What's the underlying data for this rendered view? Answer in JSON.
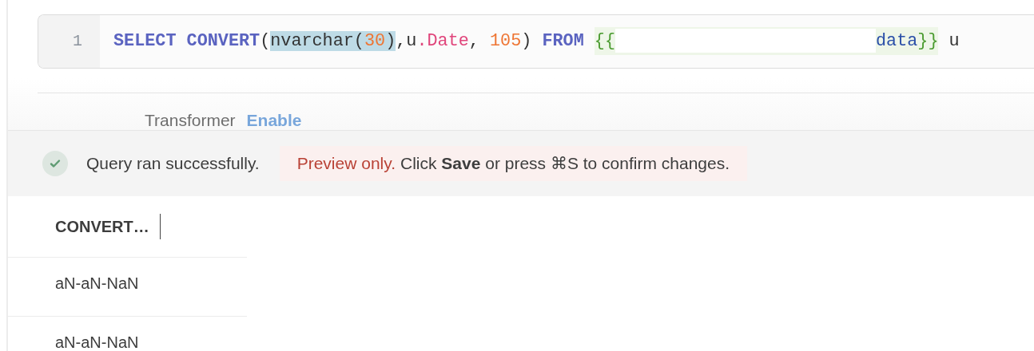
{
  "editor": {
    "line_number": "1",
    "segments": [
      {
        "selected": false,
        "tokens": [
          {
            "kind": "keyword",
            "text": "SELECT"
          },
          {
            "kind": "space"
          },
          {
            "kind": "keyword",
            "text": "CONVERT"
          },
          {
            "kind": "punct",
            "text": "("
          }
        ]
      },
      {
        "selected": true,
        "tokens": [
          {
            "kind": "ident",
            "text": "nvarchar("
          },
          {
            "kind": "number",
            "text": "30"
          },
          {
            "kind": "punct",
            "text": ")"
          }
        ]
      },
      {
        "selected": false,
        "tokens": [
          {
            "kind": "punct",
            "text": ",u"
          },
          {
            "kind": "field",
            "text": ".Date"
          },
          {
            "kind": "punct",
            "text": ", "
          },
          {
            "kind": "number",
            "text": "105"
          },
          {
            "kind": "punct",
            "text": ")"
          },
          {
            "kind": "space"
          },
          {
            "kind": "keyword",
            "text": "FROM"
          },
          {
            "kind": "space"
          },
          {
            "kind": "template",
            "open": "{{",
            "name": "data",
            "close": "}}"
          },
          {
            "kind": "space"
          },
          {
            "kind": "ident",
            "text": "u"
          }
        ]
      }
    ]
  },
  "transformer": {
    "label": "Transformer",
    "action": "Enable"
  },
  "status": {
    "ok": true,
    "message": "Query ran successfully.",
    "notice": "Preview only.",
    "hint": "Click **Save** or press ⌘S to confirm changes."
  },
  "table": {
    "columns": [
      "CONVERT…"
    ],
    "rows": [
      [
        "aN-aN-NaN"
      ],
      [
        "aN-aN-NaN"
      ]
    ]
  }
}
